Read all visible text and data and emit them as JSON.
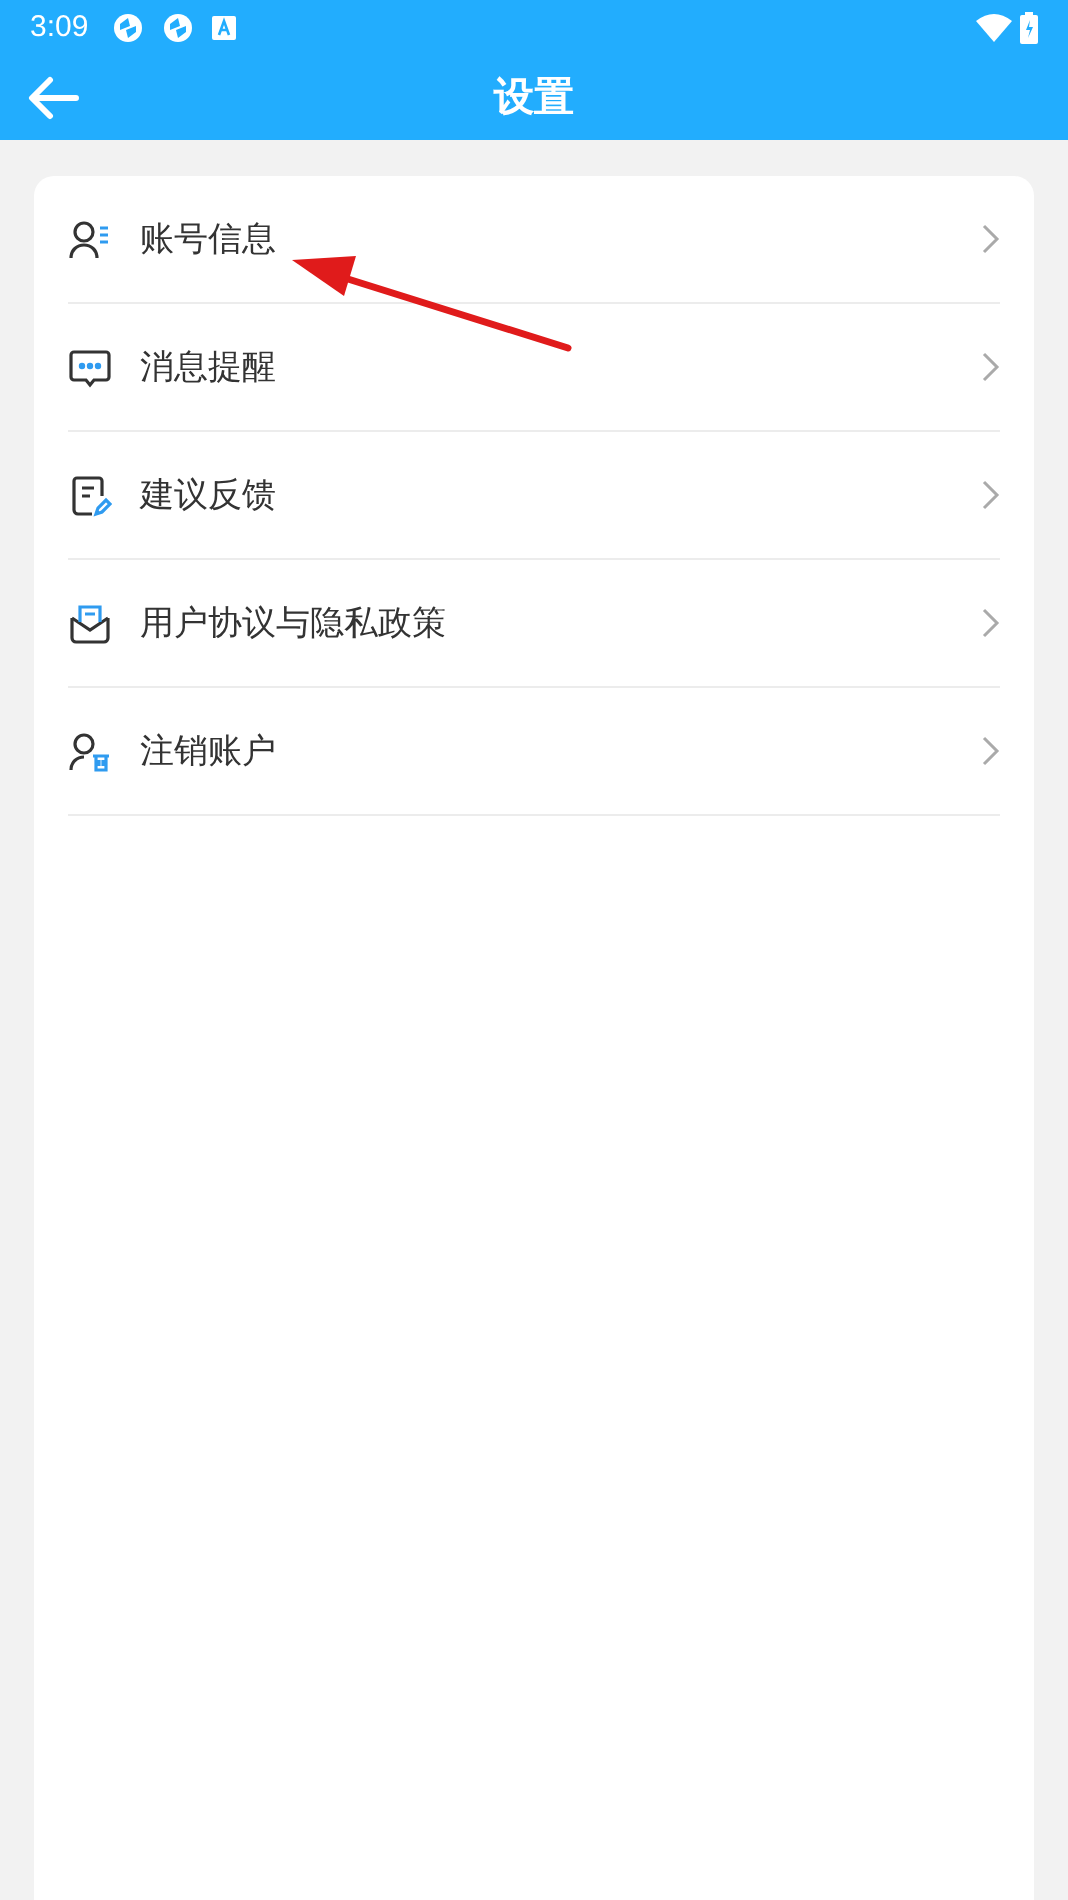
{
  "status_bar": {
    "time": "3:09"
  },
  "header": {
    "title": "设置"
  },
  "items": [
    {
      "label": "账号信息",
      "kind": "account"
    },
    {
      "label": "消息提醒",
      "kind": "message"
    },
    {
      "label": "建议反馈",
      "kind": "feedback"
    },
    {
      "label": "用户协议与隐私政策",
      "kind": "agreement"
    },
    {
      "label": "注销账户",
      "kind": "delete"
    }
  ]
}
